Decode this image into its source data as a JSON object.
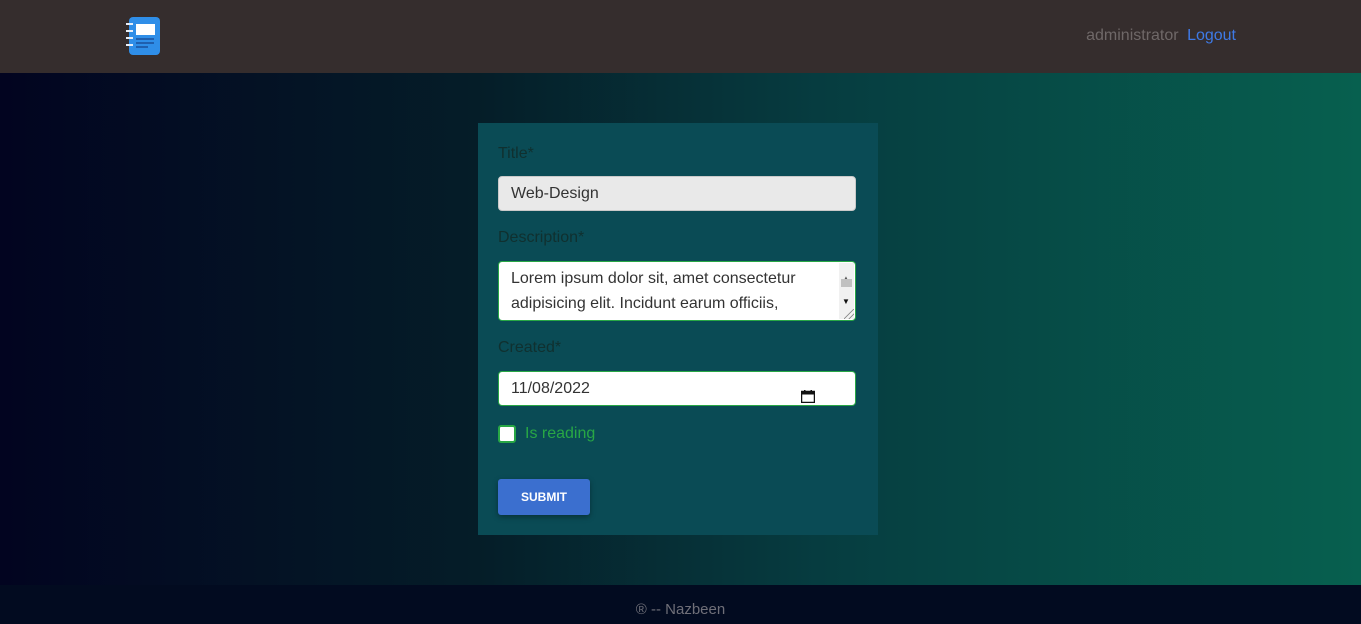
{
  "header": {
    "logo_icon": "notebook-icon",
    "username": "administrator",
    "logout_label": "Logout"
  },
  "form": {
    "title_label": "Title*",
    "title_value": "Web-Design",
    "description_label": "Description*",
    "description_value": "Lorem ipsum dolor sit, amet consectetur adipisicing elit. Incidunt earum officiis,",
    "created_label": "Created*",
    "created_value": "11/08/2022",
    "is_reading_label": "Is reading",
    "is_reading_checked": false,
    "submit_label": "SUBMIT"
  },
  "footer": {
    "text": "® -- Nazbeen"
  },
  "colors": {
    "navbar": "#352d2d",
    "card": "#0a4b55",
    "accent_green": "#28a745",
    "button_blue": "#3b6fcf",
    "link_blue": "#3e7ae6"
  }
}
